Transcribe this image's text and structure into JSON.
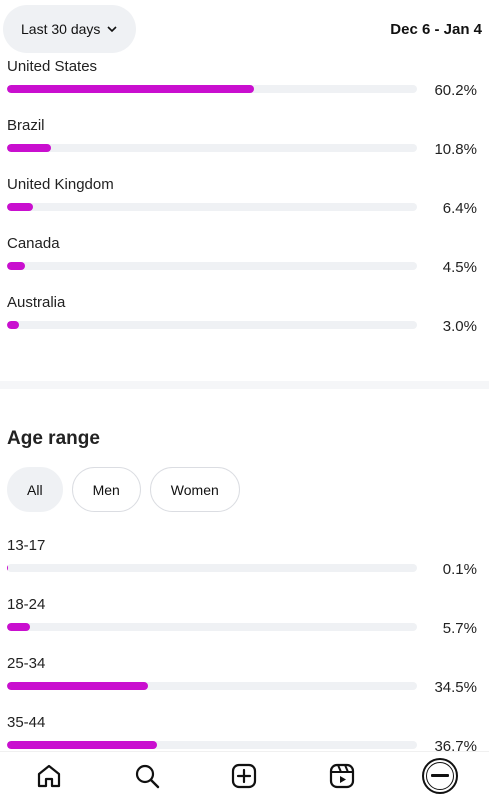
{
  "header": {
    "range_label": "Last 30 days",
    "date_range": "Dec 6 - Jan 4"
  },
  "countries": [
    {
      "label": "United States",
      "value": 60.2,
      "pct": "60.2%"
    },
    {
      "label": "Brazil",
      "value": 10.8,
      "pct": "10.8%"
    },
    {
      "label": "United Kingdom",
      "value": 6.4,
      "pct": "6.4%"
    },
    {
      "label": "Canada",
      "value": 4.5,
      "pct": "4.5%"
    },
    {
      "label": "Australia",
      "value": 3.0,
      "pct": "3.0%"
    }
  ],
  "age": {
    "title": "Age range",
    "filters": [
      "All",
      "Men",
      "Women"
    ],
    "selected": "All",
    "rows": [
      {
        "label": "13-17",
        "value": 0.1,
        "pct": "0.1%"
      },
      {
        "label": "18-24",
        "value": 5.7,
        "pct": "5.7%"
      },
      {
        "label": "25-34",
        "value": 34.5,
        "pct": "34.5%"
      },
      {
        "label": "35-44",
        "value": 36.7,
        "pct": "36.7%"
      }
    ]
  },
  "bar_scale_max": 100,
  "colors": {
    "accent": "#c90fcf",
    "track": "#eff1f4"
  },
  "nav": [
    "home-icon",
    "search-icon",
    "create-icon",
    "reels-icon",
    "profile-avatar"
  ]
}
